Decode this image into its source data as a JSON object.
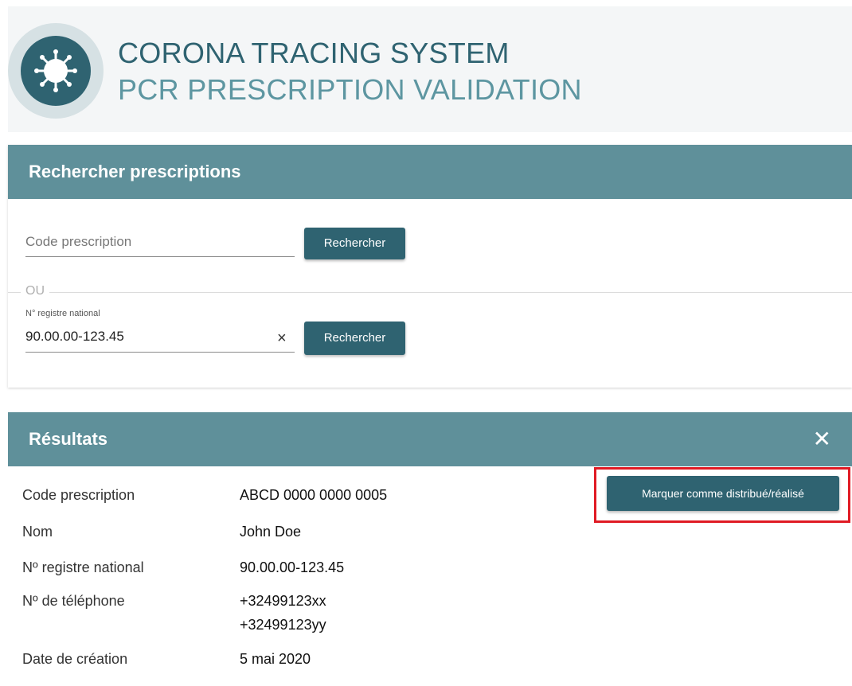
{
  "header": {
    "title": "CORONA TRACING SYSTEM",
    "subtitle": "PCR PRESCRIPTION VALIDATION",
    "logo_icon": "virus-icon"
  },
  "search": {
    "title": "Rechercher prescriptions",
    "code_placeholder": "Code prescription",
    "search_button": "Rechercher",
    "separator": "OU",
    "national_label": "N° registre national",
    "national_value": "90.00.00-123.45",
    "clear_icon": "×",
    "search_button2": "Rechercher"
  },
  "results": {
    "title": "Résultats",
    "close_icon": "✕",
    "action_button": "Marquer comme distribué/réalisé",
    "rows": [
      {
        "label": "Code prescription",
        "value": "ABCD 0000 0000 0005"
      },
      {
        "label": "Nom",
        "value": "John Doe"
      },
      {
        "label": "Nº registre national",
        "value": "90.00.00-123.45"
      },
      {
        "label": "Nº de téléphone",
        "value": "+32499123xx",
        "value2": "+32499123yy"
      },
      {
        "label": "Date de création",
        "value": "5 mai 2020"
      }
    ]
  },
  "colors": {
    "primary": "#2f6371",
    "header_bar": "#5f909a",
    "highlight": "#e01b24"
  }
}
